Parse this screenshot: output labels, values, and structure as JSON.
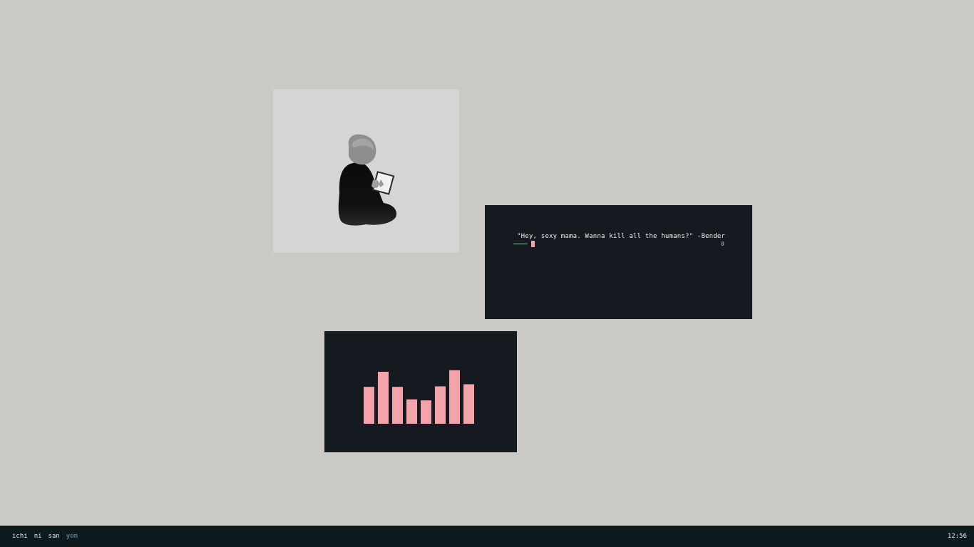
{
  "image_viewer": {
    "picture": "person-reading-book",
    "background_color": "#d5d5d5"
  },
  "terminal": {
    "quote": "\"Hey, sexy mama. Wanna kill all the humans?\" -Bender",
    "status_value": "0",
    "accent_color": "#8fc7a5",
    "cursor_color": "#f4a3ab"
  },
  "visualizer": {
    "bar_color": "#f4a3ab",
    "levels": [
      0.71,
      1.0,
      0.71,
      0.47,
      0.45,
      0.72,
      1.03,
      0.76
    ]
  },
  "taskbar": {
    "workspaces": [
      {
        "label": "ichi",
        "active": false
      },
      {
        "label": "ni",
        "active": false
      },
      {
        "label": "san",
        "active": false
      },
      {
        "label": "yon",
        "active": true
      }
    ],
    "clock": "12:56"
  }
}
